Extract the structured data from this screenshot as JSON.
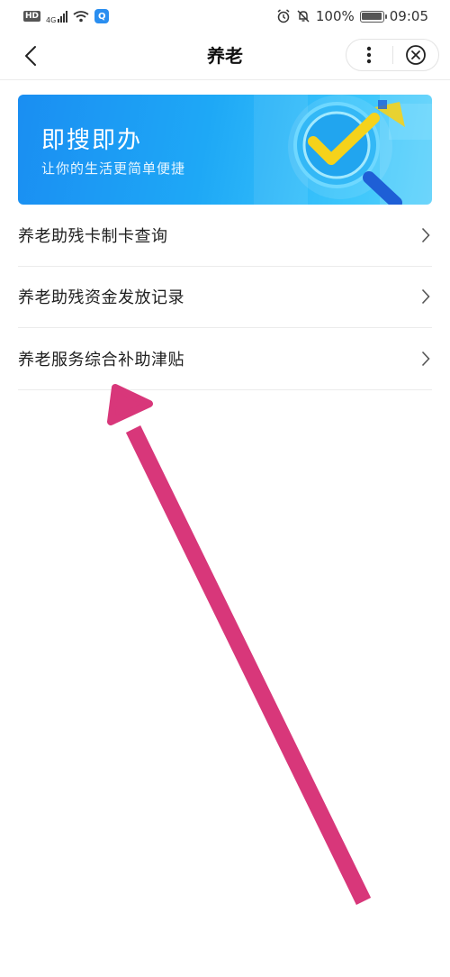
{
  "status_bar": {
    "left_badges": {
      "hd": "HD",
      "network": "4G"
    },
    "app_icon": "Q",
    "battery_percent": "100%",
    "time": "09:05",
    "icons": [
      "hd-icon",
      "signal-icon",
      "wifi-icon",
      "app-icon",
      "alarm-icon",
      "mute-icon",
      "battery-icon"
    ]
  },
  "header": {
    "title": "养老",
    "icons": [
      "back-icon",
      "more-icon",
      "close-icon"
    ]
  },
  "banner": {
    "title": "即搜即办",
    "subtitle": "让你的生活更简单便捷",
    "art_icon": "search-check-icon"
  },
  "menu": {
    "items": [
      {
        "label": "养老助残卡制卡查询"
      },
      {
        "label": "养老助残资金发放记录"
      },
      {
        "label": "养老服务综合补助津贴"
      }
    ]
  },
  "colors": {
    "banner_start": "#1a8ef2",
    "banner_end": "#59d0fb",
    "annotation_arrow": "#d8377a",
    "check_mark": "#f5d21b"
  },
  "annotation": {
    "type": "arrow",
    "target": "menu-item-3"
  }
}
